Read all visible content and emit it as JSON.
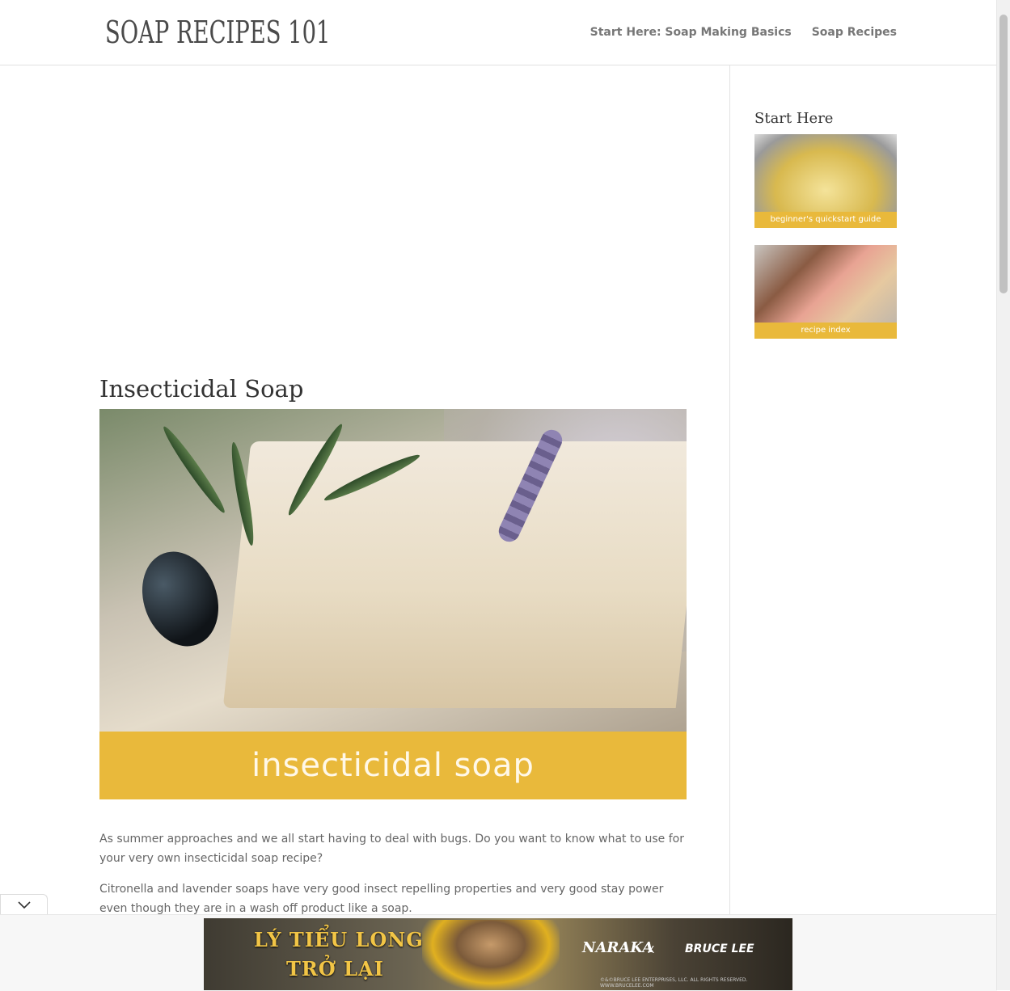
{
  "header": {
    "logo": "SOAP RECIPES 101",
    "nav": [
      "Start Here: Soap Making Basics",
      "Soap Recipes"
    ]
  },
  "post": {
    "title": "Insecticidal Soap",
    "image_banner": "insecticidal soap",
    "paragraphs": [
      "As summer approaches and we all start having to deal with bugs. Do you want to know what to use for your very own insecticidal soap recipe?",
      "Citronella and lavender soaps have very good insect repelling properties and very good stay power even though they are in a wash off product like a soap."
    ]
  },
  "sidebar": {
    "widget_title": "Start Here",
    "promos": [
      "beginner's quickstart guide",
      "recipe index"
    ]
  },
  "ad": {
    "toggle_icon": "chevron-down-icon",
    "headline_1": "LÝ TIỂU LONG",
    "headline_2": "TRỞ LẠI",
    "brand_1": "NARAKA",
    "separator": "X",
    "brand_2": "BRUCE LEE",
    "fine_print": "©&©BRUCE LEE ENTERPRISES, LLC. ALL RIGHTS RESERVED. WWW.BRUCELEE.COM"
  },
  "colors": {
    "accent": "#e9b93b",
    "text": "#666666",
    "heading": "#333333"
  }
}
